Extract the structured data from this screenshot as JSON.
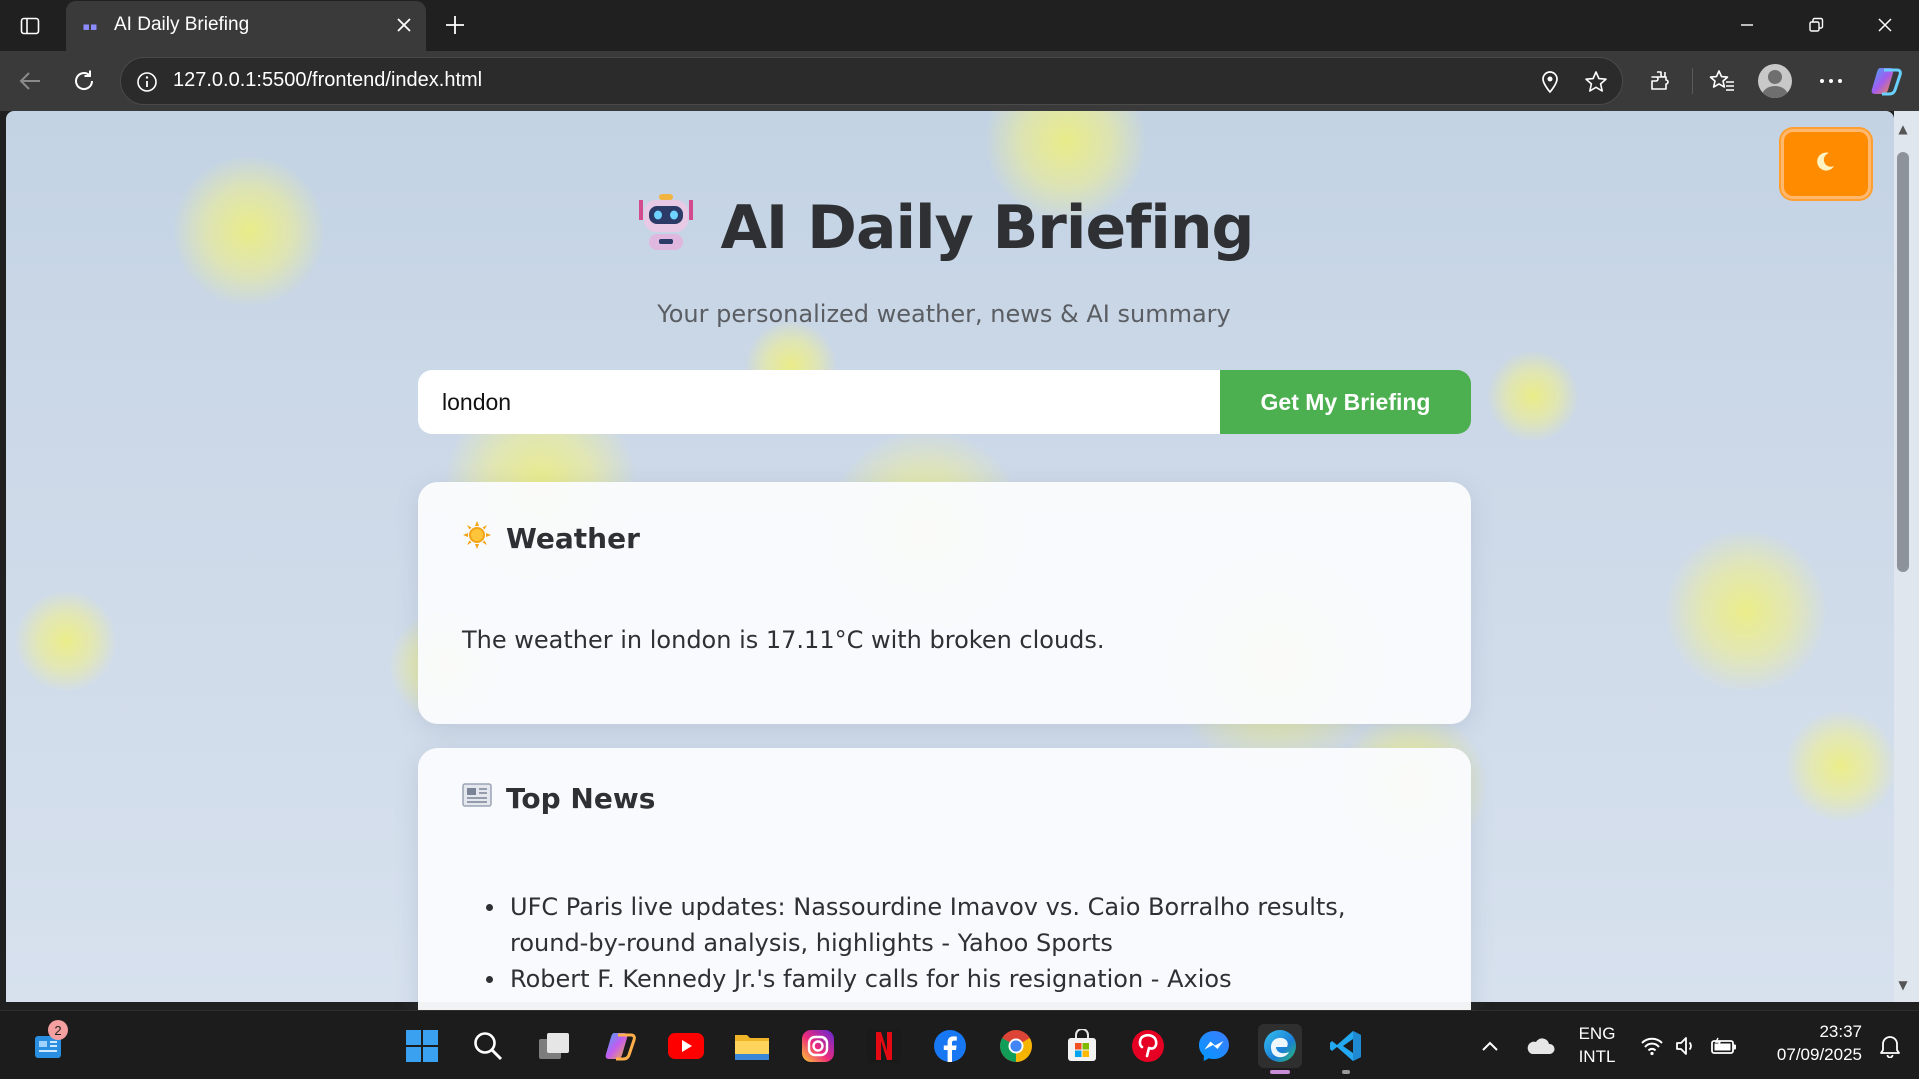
{
  "browser": {
    "tab_title": "AI Daily Briefing",
    "url": "127.0.0.1:5500/frontend/index.html"
  },
  "page": {
    "title": "AI Daily Briefing",
    "subtitle": "Your personalized weather, news & AI summary",
    "search": {
      "value": "london",
      "button_label": "Get My Briefing"
    },
    "weather": {
      "heading": "Weather",
      "text": "The weather in london is 17.11°C with broken clouds."
    },
    "news": {
      "heading": "Top News",
      "items": [
        "UFC Paris live updates: Nassourdine Imavov vs. Caio Borralho results, round-by-round analysis, highlights - Yahoo Sports",
        "Robert F. Kennedy Jr.'s family calls for his resignation - Axios"
      ]
    },
    "theme_toggle_icon": "moon-icon",
    "colors": {
      "accent_green": "#4caf50",
      "toggle_orange": "#ff8c00"
    }
  },
  "taskbar": {
    "widgets_badge": "2",
    "language": "ENG",
    "layout": "INTL",
    "time": "23:37",
    "date": "07/09/2025"
  }
}
